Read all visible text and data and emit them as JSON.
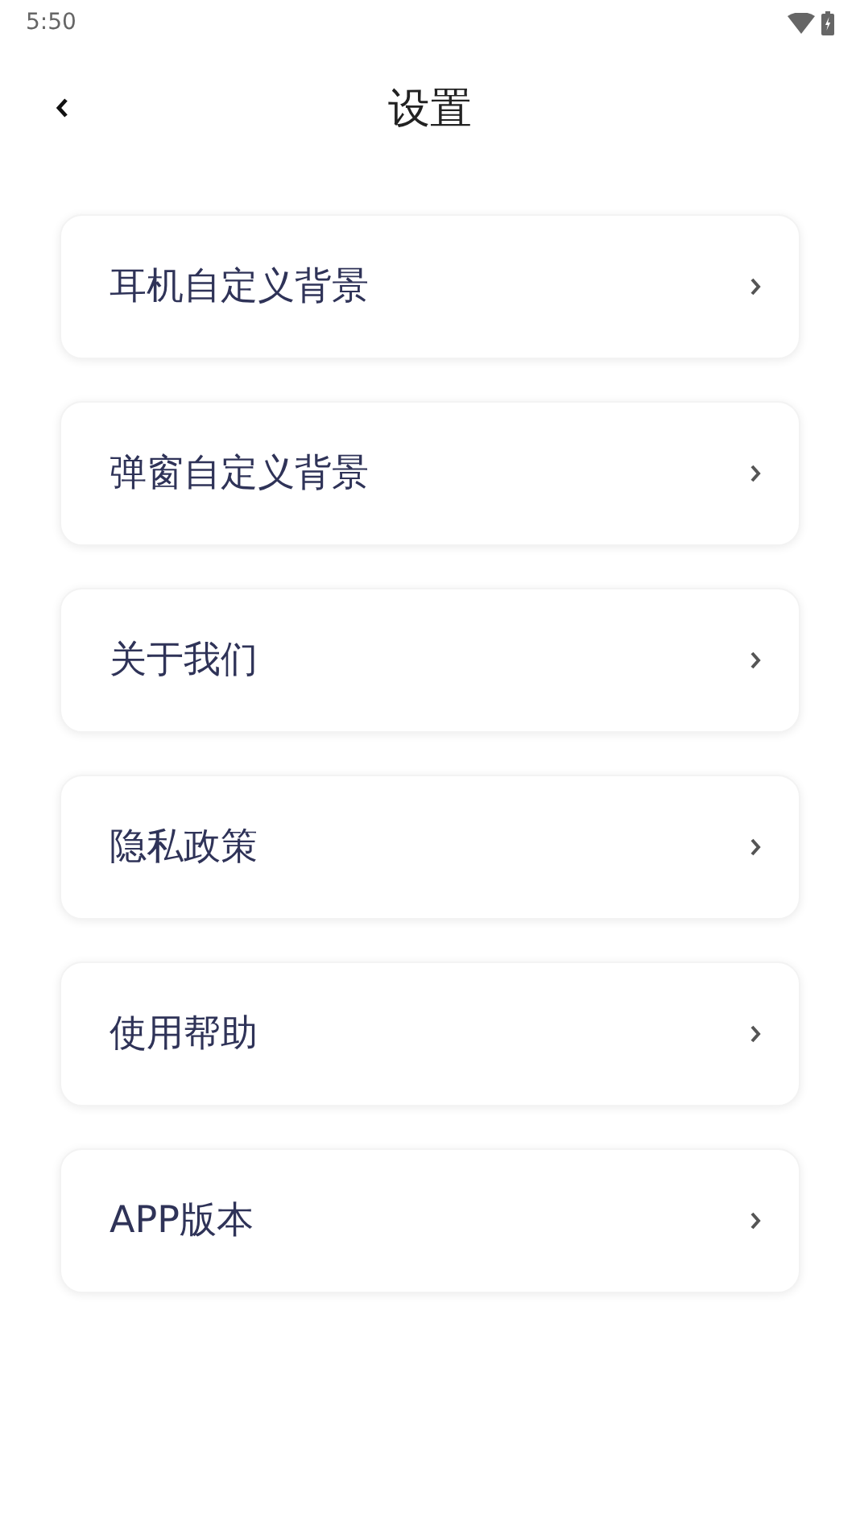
{
  "status_bar": {
    "time": "5:50"
  },
  "header": {
    "title": "设置"
  },
  "items": [
    {
      "label": "耳机自定义背景"
    },
    {
      "label": "弹窗自定义背景"
    },
    {
      "label": "关于我们"
    },
    {
      "label": "隐私政策"
    },
    {
      "label": "使用帮助"
    },
    {
      "label": "APP版本"
    }
  ]
}
